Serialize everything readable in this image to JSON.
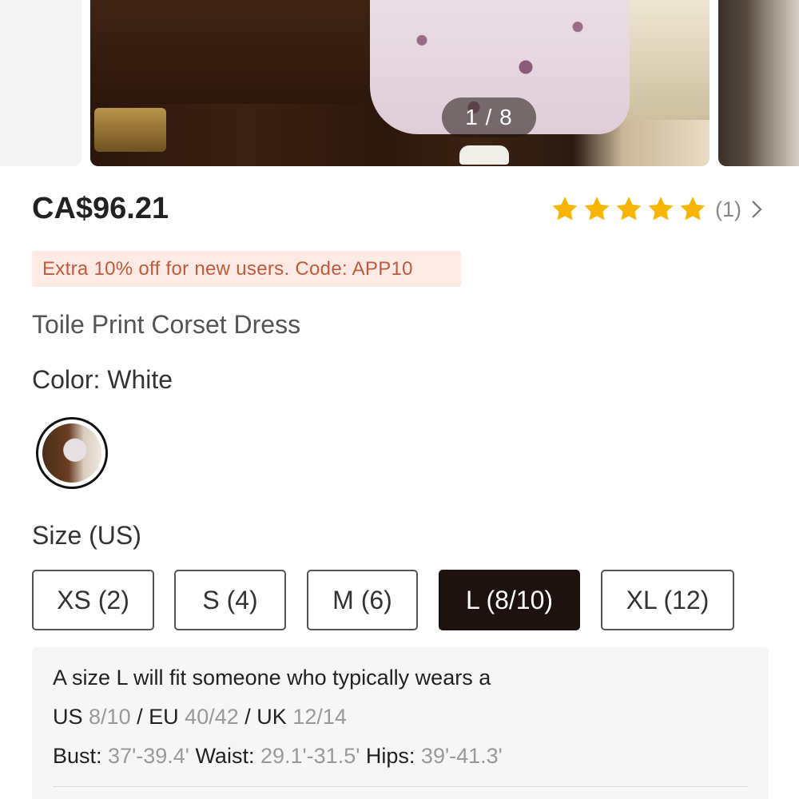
{
  "carousel": {
    "counter": "1 / 8"
  },
  "product": {
    "price": "CA$96.21",
    "rating": {
      "stars": 5,
      "review_count": "(1)"
    },
    "promo": "Extra 10% off for new users. Code: APP10",
    "title": "Toile Print Corset Dress",
    "color_label": "Color: White"
  },
  "size": {
    "label": "Size (US)",
    "options": [
      "XS (2)",
      "S (4)",
      "M (6)",
      "L (8/10)",
      "XL (12)"
    ],
    "selected": "L (8/10)"
  },
  "fit": {
    "intro": "A size L will fit someone who typically wears a",
    "us_label": "US",
    "us_value": "8/10",
    "sep1": "/",
    "eu_label": "EU",
    "eu_value": "40/42",
    "sep2": "/",
    "uk_label": "UK",
    "uk_value": "12/14",
    "bust_label": "Bust:",
    "bust_value": "37'-39.4'",
    "waist_label": "Waist:",
    "waist_value": "29.1'-31.5'",
    "hips_label": "Hips:",
    "hips_value": "39'-41.3'"
  },
  "colors": {
    "star": "#f7b500",
    "promo_bg": "#fdeae4",
    "promo_text": "#c05a3e",
    "selected_size_bg": "#1e1210"
  }
}
